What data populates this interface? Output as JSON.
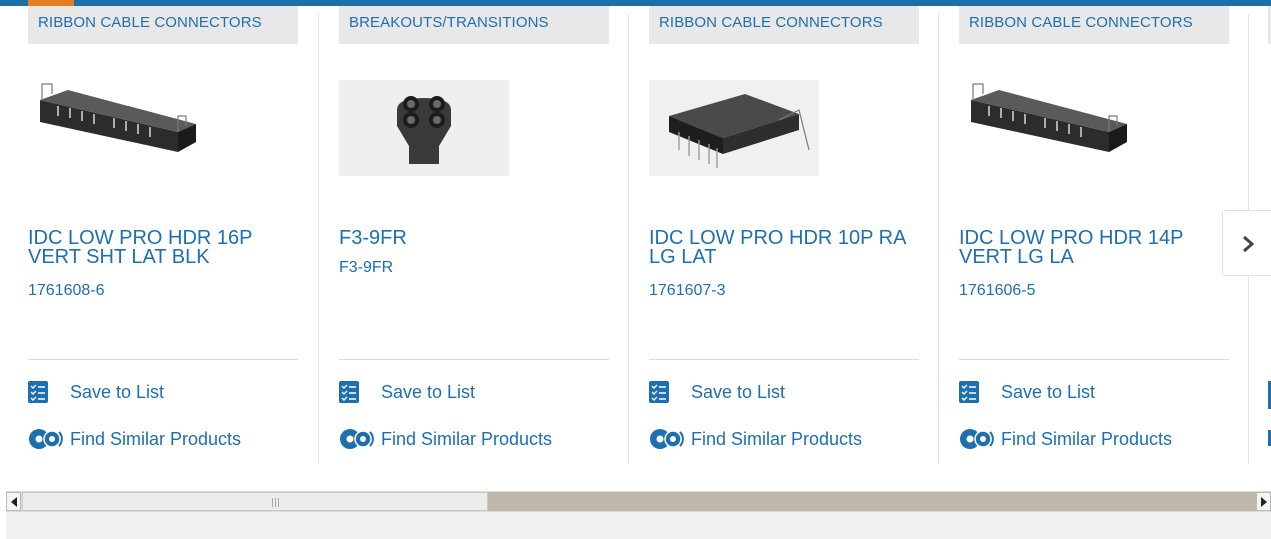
{
  "products": [
    {
      "category": "RIBBON CABLE CONNECTORS",
      "image": "idc-header-vertical-latch",
      "title": "IDC LOW PRO HDR 16P VERT SHT LAT BLK",
      "part_number": "1761608-6",
      "save_label": "Save to List",
      "similar_label": "Find Similar Products"
    },
    {
      "category": "BREAKOUTS/TRANSITIONS",
      "image": "four-way-breakout-boot",
      "title": "F3-9FR",
      "part_number": "F3-9FR",
      "save_label": "Save to List",
      "similar_label": "Find Similar Products"
    },
    {
      "category": "RIBBON CABLE CONNECTORS",
      "image": "idc-header-right-angle",
      "title": "IDC LOW PRO HDR 10P RA LG LAT",
      "part_number": "1761607-3",
      "save_label": "Save to List",
      "similar_label": "Find Similar Products"
    },
    {
      "category": "RIBBON CABLE CONNECTORS",
      "image": "idc-header-vertical-latch",
      "title": "IDC LOW PRO HDR 14P VERT LG LA",
      "part_number": "1761606-5",
      "save_label": "Save to List",
      "similar_label": "Find Similar Products"
    }
  ],
  "icons": {
    "save": "checklist-icon",
    "similar": "gears-icon",
    "next": "chevron-right-icon"
  },
  "colors": {
    "link": "#1e6fb0",
    "top_bar": "#1a70a8",
    "active_indicator": "#e57e22",
    "category_bg": "#e8e8e8"
  }
}
